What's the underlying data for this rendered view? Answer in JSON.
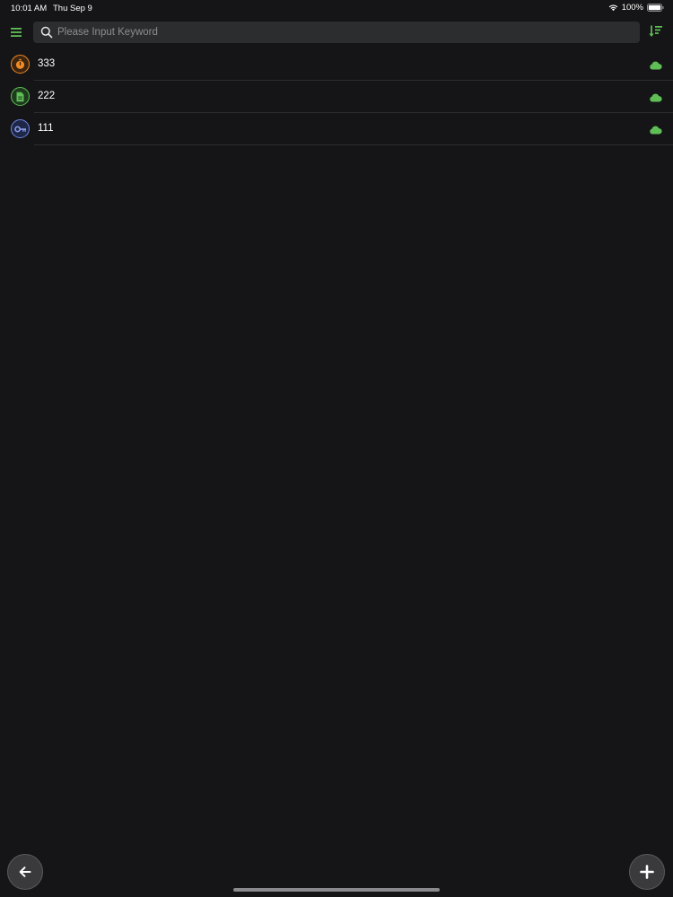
{
  "status_bar": {
    "time": "10:01 AM",
    "date": "Thu Sep 9",
    "battery": "100%"
  },
  "search": {
    "placeholder": "Please Input Keyword",
    "value": ""
  },
  "items": [
    {
      "label": "333",
      "icon": "stopwatch-icon",
      "icon_color": "#f08a24",
      "synced": true
    },
    {
      "label": "222",
      "icon": "document-icon",
      "icon_color": "#5fbf56",
      "synced": true
    },
    {
      "label": "111",
      "icon": "key-icon",
      "icon_color": "#6f86e0",
      "synced": true
    }
  ],
  "colors": {
    "background": "#151517",
    "accent": "#5fbf56",
    "search_bg": "#2b2d2e"
  }
}
